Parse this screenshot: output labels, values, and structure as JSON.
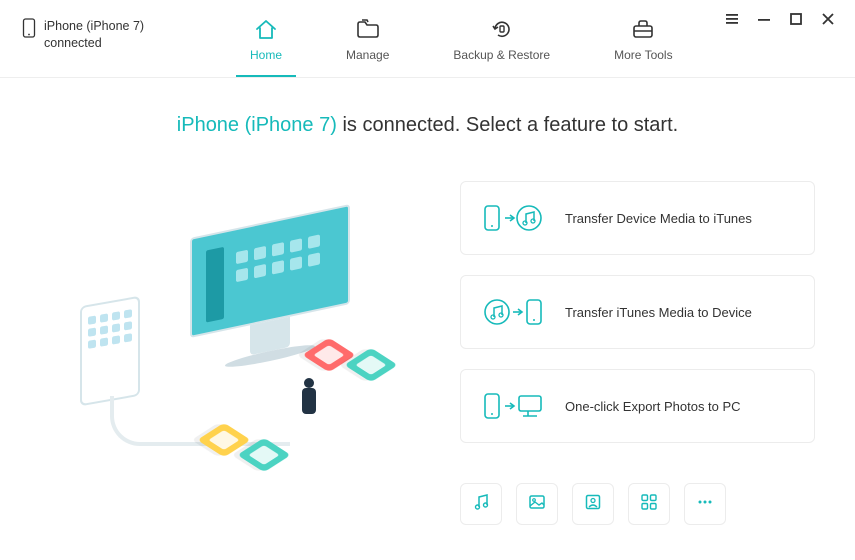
{
  "device_status": {
    "name": "iPhone (iPhone 7)",
    "state": "connected"
  },
  "nav": {
    "home": "Home",
    "manage": "Manage",
    "backup": "Backup & Restore",
    "tools": "More Tools",
    "active": "home"
  },
  "headline": {
    "device": "iPhone (iPhone 7)",
    "suffix": " is connected. Select a feature to start."
  },
  "features": [
    {
      "label": "Transfer Device Media to iTunes",
      "icon": "device-to-itunes-icon"
    },
    {
      "label": "Transfer iTunes Media to Device",
      "icon": "itunes-to-device-icon"
    },
    {
      "label": "One-click Export Photos to PC",
      "icon": "device-to-pc-icon"
    }
  ],
  "quick": [
    {
      "icon": "music-icon"
    },
    {
      "icon": "image-icon"
    },
    {
      "icon": "profile-icon"
    },
    {
      "icon": "apps-icon"
    },
    {
      "icon": "more-icon"
    }
  ],
  "colors": {
    "accent": "#16baba"
  }
}
